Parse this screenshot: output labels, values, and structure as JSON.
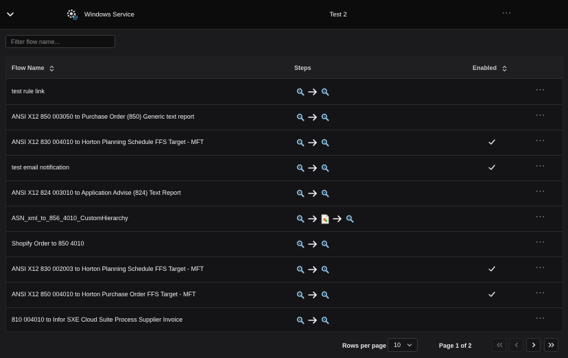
{
  "header": {
    "service_name": "Windows Service",
    "connection_name": "Test 2",
    "more_label": "···"
  },
  "filter": {
    "placeholder": "Filter flow name..."
  },
  "table": {
    "columns": [
      "Flow Name",
      "Steps",
      "Enabled"
    ],
    "rows": [
      {
        "name": "test rule link",
        "steps": [
          "search-icon",
          "arrow-right-icon",
          "search-icon"
        ],
        "enabled": false
      },
      {
        "name": "ANSI X12 850 003050 to Purchase Order (850) Generic text report",
        "steps": [
          "search-icon",
          "arrow-right-icon",
          "search-icon"
        ],
        "enabled": false
      },
      {
        "name": "ANSI X12 830 004010 to Horton Planning Schedule FFS Target - MFT",
        "steps": [
          "search-icon",
          "arrow-right-icon",
          "search-icon"
        ],
        "enabled": true
      },
      {
        "name": "test email notification",
        "steps": [
          "search-icon",
          "arrow-right-icon",
          "search-icon"
        ],
        "enabled": true
      },
      {
        "name": "ANSI X12 824 003010 to Application Advise (824) Text Report",
        "steps": [
          "search-icon",
          "arrow-right-icon",
          "search-icon"
        ],
        "enabled": false
      },
      {
        "name": "ASN_xml_to_856_4010_CustomHierarchy",
        "steps": [
          "search-icon",
          "arrow-right-icon",
          "document-icon",
          "arrow-right-icon",
          "search-icon"
        ],
        "enabled": false
      },
      {
        "name": "Shopify Order to 850 4010",
        "steps": [
          "search-icon",
          "arrow-right-icon",
          "search-icon"
        ],
        "enabled": false
      },
      {
        "name": "ANSI X12 830 002003 to Horton Planning Schedule FFS Target - MFT",
        "steps": [
          "search-icon",
          "arrow-right-icon",
          "search-icon"
        ],
        "enabled": true
      },
      {
        "name": "ANSI X12 850 004010 to Horton Purchase Order FFS Target - MFT",
        "steps": [
          "search-icon",
          "arrow-right-icon",
          "search-icon"
        ],
        "enabled": true
      },
      {
        "name": "810 004010 to Infor SXE Cloud Suite Process Supplier Invoice",
        "steps": [
          "search-icon",
          "arrow-right-icon",
          "search-icon"
        ],
        "enabled": false
      }
    ]
  },
  "pagination": {
    "rows_per_page_label": "Rows per page",
    "rows_per_page_value": "10",
    "page_info": "Page 1 of 2"
  },
  "colors": {
    "background": "#1b1b1d",
    "topbar": "#0c0c0d",
    "search_icon": "#8fc3e6",
    "text": "#e6e6e6"
  }
}
